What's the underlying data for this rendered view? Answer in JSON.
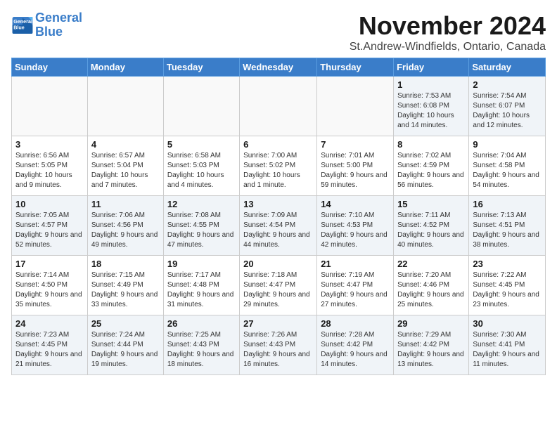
{
  "logo": {
    "line1": "General",
    "line2": "Blue"
  },
  "header": {
    "title": "November 2024",
    "subtitle": "St.Andrew-Windfields, Ontario, Canada"
  },
  "weekdays": [
    "Sunday",
    "Monday",
    "Tuesday",
    "Wednesday",
    "Thursday",
    "Friday",
    "Saturday"
  ],
  "weeks": [
    [
      {
        "day": "",
        "info": ""
      },
      {
        "day": "",
        "info": ""
      },
      {
        "day": "",
        "info": ""
      },
      {
        "day": "",
        "info": ""
      },
      {
        "day": "",
        "info": ""
      },
      {
        "day": "1",
        "info": "Sunrise: 7:53 AM\nSunset: 6:08 PM\nDaylight: 10 hours and 14 minutes."
      },
      {
        "day": "2",
        "info": "Sunrise: 7:54 AM\nSunset: 6:07 PM\nDaylight: 10 hours and 12 minutes."
      }
    ],
    [
      {
        "day": "3",
        "info": "Sunrise: 6:56 AM\nSunset: 5:05 PM\nDaylight: 10 hours and 9 minutes."
      },
      {
        "day": "4",
        "info": "Sunrise: 6:57 AM\nSunset: 5:04 PM\nDaylight: 10 hours and 7 minutes."
      },
      {
        "day": "5",
        "info": "Sunrise: 6:58 AM\nSunset: 5:03 PM\nDaylight: 10 hours and 4 minutes."
      },
      {
        "day": "6",
        "info": "Sunrise: 7:00 AM\nSunset: 5:02 PM\nDaylight: 10 hours and 1 minute."
      },
      {
        "day": "7",
        "info": "Sunrise: 7:01 AM\nSunset: 5:00 PM\nDaylight: 9 hours and 59 minutes."
      },
      {
        "day": "8",
        "info": "Sunrise: 7:02 AM\nSunset: 4:59 PM\nDaylight: 9 hours and 56 minutes."
      },
      {
        "day": "9",
        "info": "Sunrise: 7:04 AM\nSunset: 4:58 PM\nDaylight: 9 hours and 54 minutes."
      }
    ],
    [
      {
        "day": "10",
        "info": "Sunrise: 7:05 AM\nSunset: 4:57 PM\nDaylight: 9 hours and 52 minutes."
      },
      {
        "day": "11",
        "info": "Sunrise: 7:06 AM\nSunset: 4:56 PM\nDaylight: 9 hours and 49 minutes."
      },
      {
        "day": "12",
        "info": "Sunrise: 7:08 AM\nSunset: 4:55 PM\nDaylight: 9 hours and 47 minutes."
      },
      {
        "day": "13",
        "info": "Sunrise: 7:09 AM\nSunset: 4:54 PM\nDaylight: 9 hours and 44 minutes."
      },
      {
        "day": "14",
        "info": "Sunrise: 7:10 AM\nSunset: 4:53 PM\nDaylight: 9 hours and 42 minutes."
      },
      {
        "day": "15",
        "info": "Sunrise: 7:11 AM\nSunset: 4:52 PM\nDaylight: 9 hours and 40 minutes."
      },
      {
        "day": "16",
        "info": "Sunrise: 7:13 AM\nSunset: 4:51 PM\nDaylight: 9 hours and 38 minutes."
      }
    ],
    [
      {
        "day": "17",
        "info": "Sunrise: 7:14 AM\nSunset: 4:50 PM\nDaylight: 9 hours and 35 minutes."
      },
      {
        "day": "18",
        "info": "Sunrise: 7:15 AM\nSunset: 4:49 PM\nDaylight: 9 hours and 33 minutes."
      },
      {
        "day": "19",
        "info": "Sunrise: 7:17 AM\nSunset: 4:48 PM\nDaylight: 9 hours and 31 minutes."
      },
      {
        "day": "20",
        "info": "Sunrise: 7:18 AM\nSunset: 4:47 PM\nDaylight: 9 hours and 29 minutes."
      },
      {
        "day": "21",
        "info": "Sunrise: 7:19 AM\nSunset: 4:47 PM\nDaylight: 9 hours and 27 minutes."
      },
      {
        "day": "22",
        "info": "Sunrise: 7:20 AM\nSunset: 4:46 PM\nDaylight: 9 hours and 25 minutes."
      },
      {
        "day": "23",
        "info": "Sunrise: 7:22 AM\nSunset: 4:45 PM\nDaylight: 9 hours and 23 minutes."
      }
    ],
    [
      {
        "day": "24",
        "info": "Sunrise: 7:23 AM\nSunset: 4:45 PM\nDaylight: 9 hours and 21 minutes."
      },
      {
        "day": "25",
        "info": "Sunrise: 7:24 AM\nSunset: 4:44 PM\nDaylight: 9 hours and 19 minutes."
      },
      {
        "day": "26",
        "info": "Sunrise: 7:25 AM\nSunset: 4:43 PM\nDaylight: 9 hours and 18 minutes."
      },
      {
        "day": "27",
        "info": "Sunrise: 7:26 AM\nSunset: 4:43 PM\nDaylight: 9 hours and 16 minutes."
      },
      {
        "day": "28",
        "info": "Sunrise: 7:28 AM\nSunset: 4:42 PM\nDaylight: 9 hours and 14 minutes."
      },
      {
        "day": "29",
        "info": "Sunrise: 7:29 AM\nSunset: 4:42 PM\nDaylight: 9 hours and 13 minutes."
      },
      {
        "day": "30",
        "info": "Sunrise: 7:30 AM\nSunset: 4:41 PM\nDaylight: 9 hours and 11 minutes."
      }
    ]
  ]
}
